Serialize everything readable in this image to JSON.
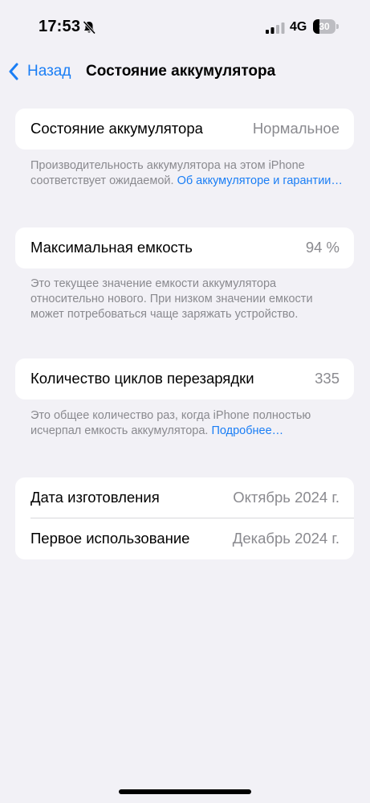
{
  "status_bar": {
    "time": "17:53",
    "network": "4G",
    "battery_level": "30",
    "battery_fraction": 0.3
  },
  "nav": {
    "back_label": "Назад",
    "title": "Состояние аккумулятора"
  },
  "health": {
    "label": "Состояние аккумулятора",
    "value": "Нормальное",
    "footer": "Производительность аккумулятора на этом iPhone соответствует ожидаемой. ",
    "footer_link": "Об аккумуляторе и гарантии…"
  },
  "capacity": {
    "label": "Максимальная емкость",
    "value": "94 %",
    "footer": "Это текущее значение емкости аккумулятора относительно нового. При низком значении емкости может потребоваться чаще заряжать устройство."
  },
  "cycles": {
    "label": "Количество циклов перезарядки",
    "value": "335",
    "footer": "Это общее количество раз, когда iPhone полностью исчерпал емкость аккумулятора. ",
    "footer_link": "Подробнее…"
  },
  "dates": {
    "manufactured_label": "Дата изготовления",
    "manufactured_value": "Октябрь 2024 г.",
    "first_use_label": "Первое использование",
    "first_use_value": "Декабрь 2024 г."
  },
  "colors": {
    "accent": "#1a7ef5",
    "background": "#f2f1f6",
    "secondary_text": "#8a8a8f"
  }
}
